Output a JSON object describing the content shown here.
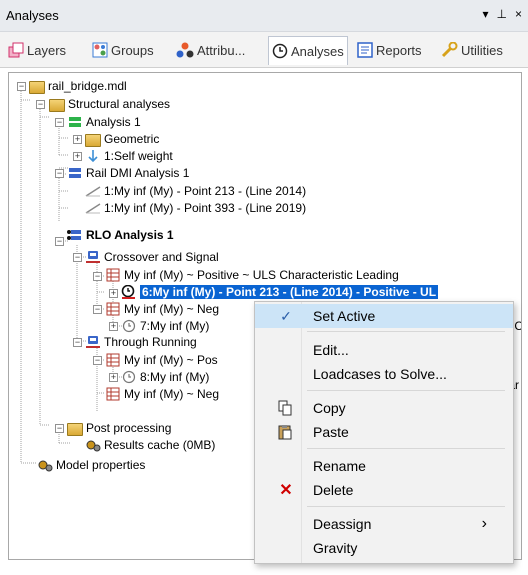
{
  "window": {
    "title": "Analyses",
    "ctrl_pin": "▾",
    "ctrl_dock": "⊥",
    "ctrl_close": "×"
  },
  "tabs": [
    {
      "label": "Layers"
    },
    {
      "label": "Groups"
    },
    {
      "label": "Attribu..."
    },
    {
      "label": "Analyses"
    },
    {
      "label": "Reports"
    },
    {
      "label": "Utilities"
    }
  ],
  "tree": {
    "root": "rail_bridge.mdl",
    "structural_analyses": "Structural analyses",
    "analysis1": "Analysis 1",
    "geometric": "Geometric",
    "self_weight": "1:Self weight",
    "rail_dmi": "Rail DMI Analysis 1",
    "dmi_point213": "1:My inf (My) - Point 213 - (Line 2014)",
    "dmi_point393": "1:My inf (My) - Point 393 - (Line 2019)",
    "rlo": "RLO Analysis 1",
    "crossover": "Crossover and Signal",
    "pos_uls": "My inf (My) ~ Positive ~ ULS Characteristic Leading",
    "item6": "6:My inf (My) - Point 213 - (Line 2014) - Positive - UL",
    "neg1": "My inf (My) ~ Neg",
    "item7": "7:My inf (My)",
    "item7_tail": "S Cha",
    "through": "Through Running",
    "pos2": "My inf (My) ~ Pos",
    "item8": "8:My inf (My)",
    "item8_tail": "Char",
    "neg2": "My inf (My) ~ Neg",
    "post": "Post processing",
    "cache": "Results cache (0MB)",
    "model_props": "Model properties"
  },
  "context_menu": {
    "set_active": "Set Active",
    "edit": "Edit...",
    "loadcases": "Loadcases to Solve...",
    "copy": "Copy",
    "paste": "Paste",
    "rename": "Rename",
    "delete": "Delete",
    "deassign": "Deassign",
    "gravity": "Gravity",
    "check_glyph": "✓",
    "delete_glyph": "✕",
    "submenu_glyph": "›"
  },
  "colors": {
    "selection": "#0a64d2",
    "menu_highlight": "#cce4f7",
    "delete_red": "#d00000"
  }
}
